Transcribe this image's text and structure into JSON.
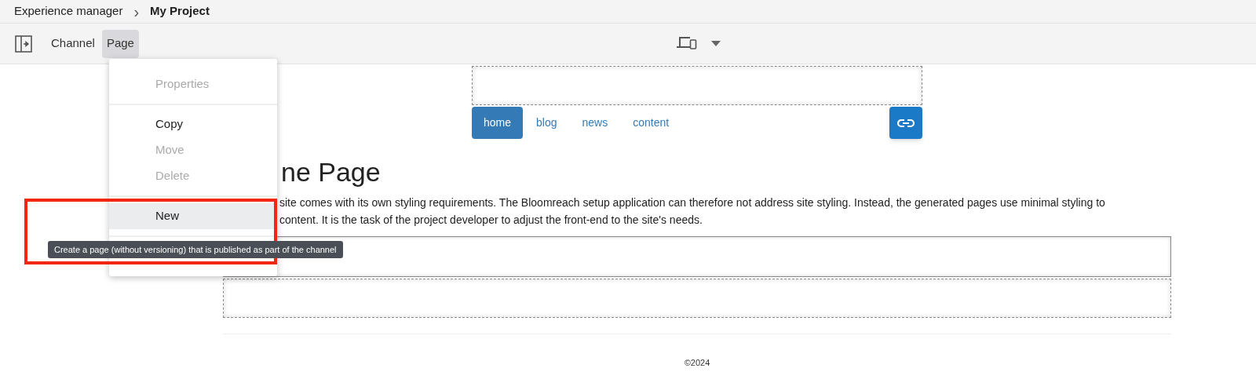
{
  "breadcrumb": {
    "parent": "Experience manager",
    "separator": "›",
    "current": "My Project"
  },
  "toolbar": {
    "tabs": [
      {
        "label": "Channel",
        "selected": false
      },
      {
        "label": "Page",
        "selected": true
      }
    ]
  },
  "page_menu": {
    "groups": [
      [
        {
          "label": "Properties",
          "disabled": true,
          "highlighted": false
        }
      ],
      [
        {
          "label": "Copy",
          "disabled": false,
          "highlighted": false
        },
        {
          "label": "Move",
          "disabled": true,
          "highlighted": false
        },
        {
          "label": "Delete",
          "disabled": true,
          "highlighted": false
        }
      ],
      [
        {
          "label": "New",
          "disabled": false,
          "highlighted": true
        }
      ]
    ]
  },
  "tooltip": "Create a page (without versioning) that is published as part of the channel",
  "site": {
    "nav": [
      {
        "label": "home",
        "selected": true
      },
      {
        "label": "blog",
        "selected": false
      },
      {
        "label": "news",
        "selected": false
      },
      {
        "label": "content",
        "selected": false
      }
    ],
    "heading": "ne Page",
    "paragraph_lines": [
      "site comes with its own styling requirements. The Bloomreach setup application can therefore not address site styling. Instead, the generated pages use minimal styling to",
      "content. It is the task of the project developer to adjust the front-end to the site's needs."
    ],
    "footer": "©2024"
  }
}
